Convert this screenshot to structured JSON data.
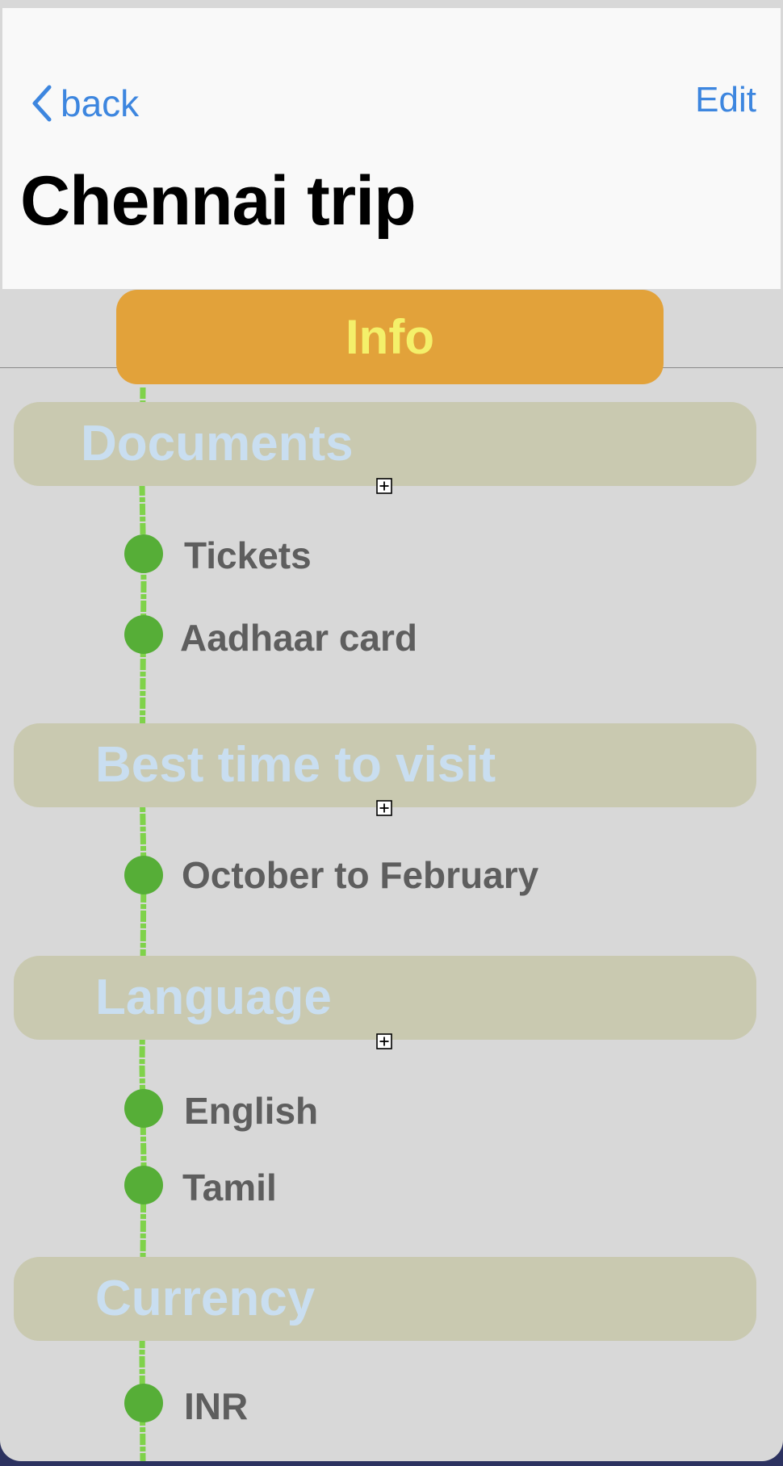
{
  "header": {
    "back_label": "back",
    "edit_label": "Edit",
    "title": "Chennai trip"
  },
  "info_button": {
    "label": "Info"
  },
  "sections": [
    {
      "title": "Documents",
      "items": [
        "Tickets",
        "Aadhaar card"
      ]
    },
    {
      "title": "Best time to visit",
      "items": [
        "October to February"
      ]
    },
    {
      "title": "Language",
      "items": [
        "English",
        "Tamil"
      ]
    },
    {
      "title": "Currency",
      "items": [
        "INR"
      ]
    }
  ],
  "colors": {
    "accent_blue": "#3d86df",
    "info_orange": "#e2a23a",
    "info_text_yellow": "#f4f06a",
    "section_background": "#c9c9b0",
    "section_title_text": "#c9def0",
    "bullet_green": "#56ae37",
    "timeline_green": "#7fd24a"
  },
  "icons": {
    "back": "chevron-left-icon",
    "add": "plus-square-icon"
  }
}
